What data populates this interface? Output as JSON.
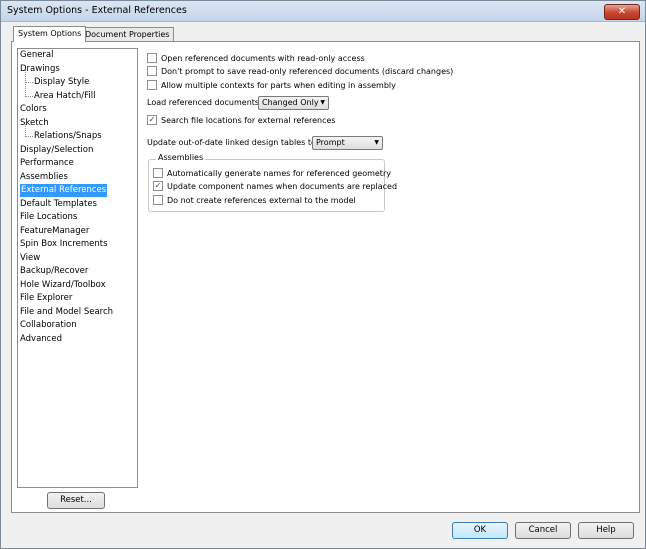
{
  "window": {
    "title": "System Options - External References",
    "close_label": "✕"
  },
  "tabs": [
    {
      "label": "System Options",
      "active": true
    },
    {
      "label": "Document Properties",
      "active": false
    }
  ],
  "tree": {
    "items": [
      {
        "label": "General"
      },
      {
        "label": "Drawings"
      },
      {
        "label": "Display Style"
      },
      {
        "label": "Area Hatch/Fill"
      },
      {
        "label": "Colors"
      },
      {
        "label": "Sketch"
      },
      {
        "label": "Relations/Snaps"
      },
      {
        "label": "Display/Selection"
      },
      {
        "label": "Performance"
      },
      {
        "label": "Assemblies"
      },
      {
        "label": "External References",
        "selected": true
      },
      {
        "label": "Default Templates"
      },
      {
        "label": "File Locations"
      },
      {
        "label": "FeatureManager"
      },
      {
        "label": "Spin Box Increments"
      },
      {
        "label": "View"
      },
      {
        "label": "Backup/Recover"
      },
      {
        "label": "Hole Wizard/Toolbox"
      },
      {
        "label": "File Explorer"
      },
      {
        "label": "File and Model Search"
      },
      {
        "label": "Collaboration"
      },
      {
        "label": "Advanced"
      }
    ],
    "reset_label": "Reset..."
  },
  "options": {
    "open_readonly": {
      "label": "Open referenced documents with read-only access",
      "checked": false
    },
    "dont_prompt": {
      "label": "Don't prompt to save read-only referenced documents (discard changes)",
      "checked": false
    },
    "multiple_contexts": {
      "label": "Allow multiple contexts for parts when editing in assembly",
      "checked": false
    },
    "load_label": "Load referenced documents:",
    "load_value": "Changed Only",
    "search_locations": {
      "label": "Search file locations for external references",
      "checked": true
    },
    "update_label": "Update out-of-date linked design tables to:",
    "update_value": "Prompt",
    "assemblies": {
      "title": "Assemblies",
      "auto_names": {
        "label": "Automatically generate names for referenced geometry",
        "checked": false
      },
      "update_names": {
        "label": "Update component names when documents are replaced",
        "checked": true
      },
      "no_external": {
        "label": "Do not create references external to the model",
        "checked": false
      }
    }
  },
  "footer": {
    "ok_label": "OK",
    "cancel_label": "Cancel",
    "help_label": "Help"
  },
  "colors": {
    "selection": "#3399ff",
    "close_button": "#c8452e"
  }
}
